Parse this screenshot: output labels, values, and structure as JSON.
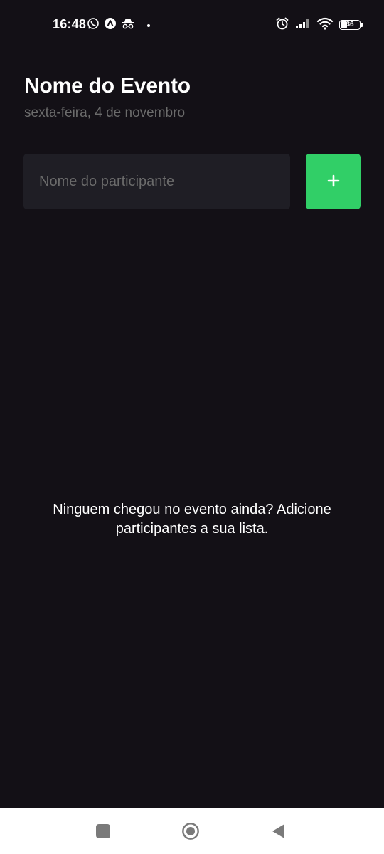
{
  "status_bar": {
    "time": "16:48",
    "battery_level": "36",
    "left_icons": [
      "whatsapp-icon",
      "app-a-icon",
      "incognito-icon",
      "dot-icon"
    ],
    "right_icons": [
      "alarm-icon",
      "signal-icon",
      "wifi-icon",
      "battery-icon"
    ]
  },
  "header": {
    "title": "Nome do Evento",
    "date": "sexta-feira, 4 de novembro"
  },
  "form": {
    "input_value": "",
    "input_placeholder": "Nome do participante",
    "add_button_label": "+",
    "add_button_icon": "plus-icon"
  },
  "empty_state": {
    "message": "Ninguem chegou no evento ainda? Adicione participantes a sua lista."
  },
  "navigation": {
    "buttons": [
      "recent-apps-icon",
      "home-icon",
      "back-icon"
    ]
  },
  "colors": {
    "background": "#131016",
    "input_background": "#1f1e25",
    "accent": "#31cf67",
    "muted_text": "#6b6b6b",
    "text": "#ffffff",
    "nav_bar": "#ffffff",
    "nav_icons": "#7a7a7a"
  }
}
